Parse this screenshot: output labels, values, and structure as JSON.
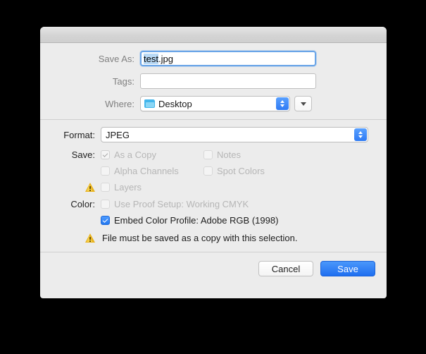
{
  "dialog": {
    "title": "",
    "save_as": {
      "label": "Save As:",
      "value_selected": "test",
      "value_rest": ".jpg",
      "full_value": "test.jpg",
      "placeholder": ""
    },
    "tags": {
      "label": "Tags:",
      "value": "",
      "placeholder": ""
    },
    "where": {
      "label": "Where:",
      "value": "Desktop",
      "icon": "folder-icon",
      "stepper_icon": "stepper-updown-icon",
      "expand_icon": "chevron-down-icon"
    },
    "format": {
      "label": "Format:",
      "value": "JPEG",
      "stepper_icon": "stepper-updown-icon"
    },
    "save_options": {
      "label": "Save:",
      "items": [
        {
          "label": "As a Copy",
          "checked": true,
          "enabled": false,
          "warning": false
        },
        {
          "label": "Notes",
          "checked": false,
          "enabled": false,
          "warning": false
        },
        {
          "label": "Alpha Channels",
          "checked": false,
          "enabled": false,
          "warning": false
        },
        {
          "label": "Spot Colors",
          "checked": false,
          "enabled": false,
          "warning": false
        },
        {
          "label": "Layers",
          "checked": false,
          "enabled": false,
          "warning": true
        }
      ]
    },
    "color_options": {
      "label": "Color:",
      "items": [
        {
          "label": "Use Proof Setup:  Working CMYK",
          "checked": false,
          "enabled": false
        },
        {
          "label": "Embed Color Profile:  Adobe RGB (1998)",
          "checked": true,
          "enabled": true
        }
      ]
    },
    "warning": {
      "icon": "warning-triangle-icon",
      "message": "File must be saved as a copy with this selection."
    },
    "buttons": {
      "cancel": "Cancel",
      "save": "Save"
    }
  },
  "colors": {
    "accent": "#2277f0",
    "warning": "#e8b320",
    "dialog_bg": "#ececec",
    "selection": "#b9d9f5"
  }
}
